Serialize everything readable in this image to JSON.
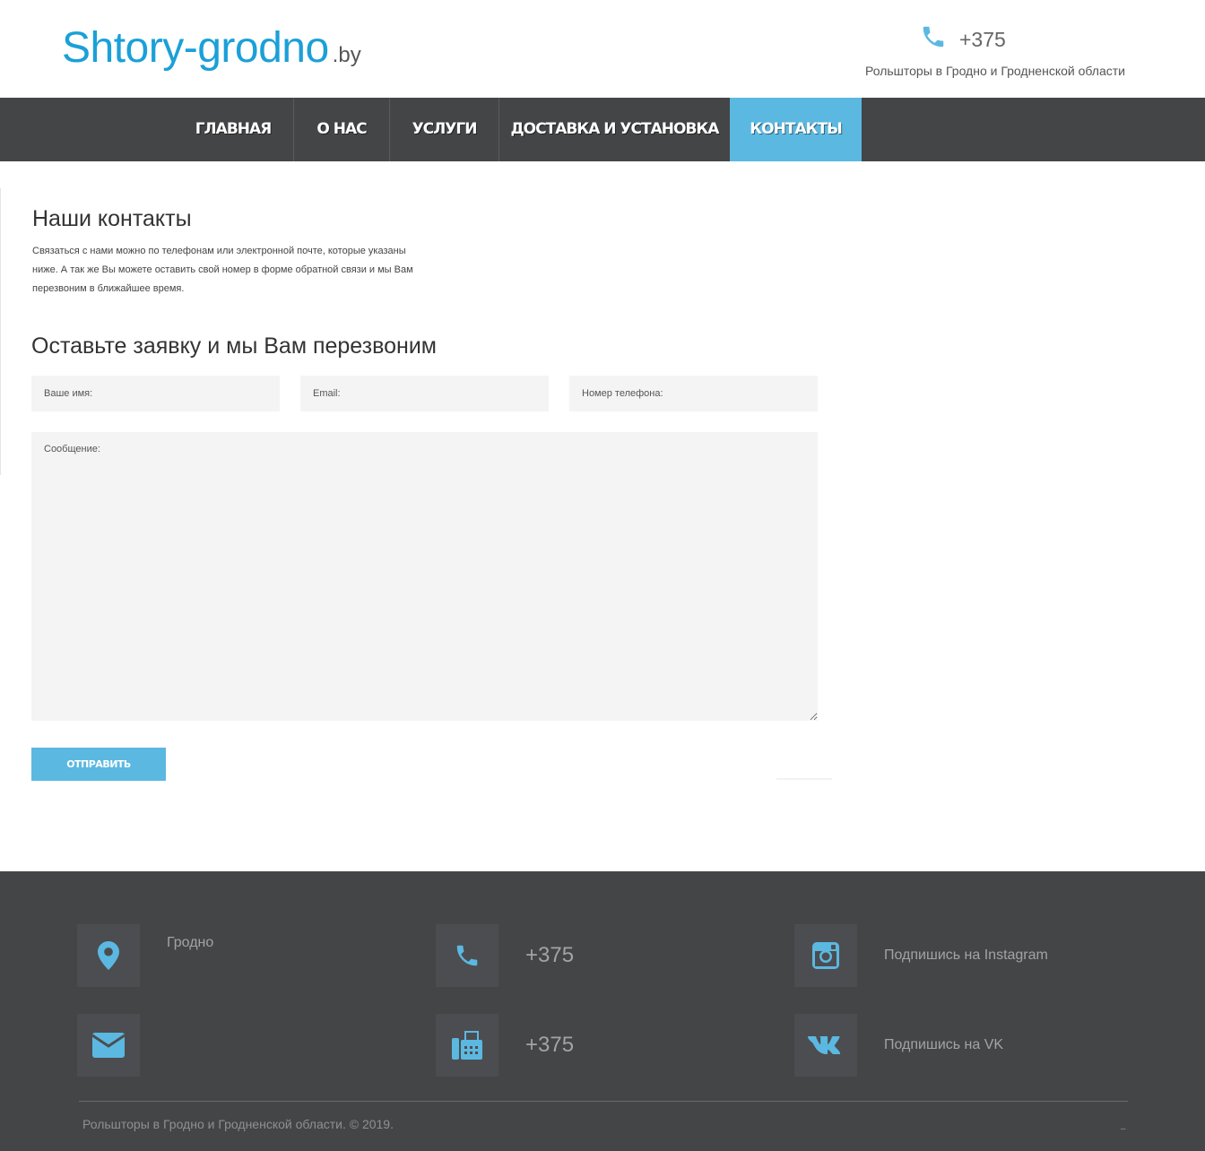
{
  "header": {
    "logo_main": "Shtory-grodno",
    "logo_tld": ".by",
    "phone": "+375",
    "subtitle": "Рольшторы в Гродно и Гродненской области"
  },
  "nav": {
    "items": [
      {
        "label": "ГЛАВНАЯ",
        "active": false
      },
      {
        "label": "О НАС",
        "active": false
      },
      {
        "label": "УСЛУГИ",
        "active": false
      },
      {
        "label": "ДОСТАВКА И УСТАНОВКА",
        "active": false
      },
      {
        "label": "КОНТАКТЫ",
        "active": true
      }
    ]
  },
  "contacts": {
    "title": "Наши контакты",
    "text": "Связаться с нами можно по телефонам или электронной почте, которые указаны ниже. А так же Вы можете оставить свой номер в форме обратной связи и мы Вам перезвоним в ближайшее время."
  },
  "form": {
    "title": "Оставьте заявку и мы Вам перезвоним",
    "name_placeholder": "Ваше имя:",
    "email_placeholder": "Email:",
    "phone_placeholder": "Номер телефона:",
    "message_placeholder": "Сообщение:",
    "submit_label": "ОТПРАВИТЬ"
  },
  "footer": {
    "city": "Гродно",
    "phone": "+375",
    "fax": "+375",
    "instagram": "Подпишись на Instagram",
    "vk": "Подпишись на VK",
    "copyright": "Рольшторы в Гродно и Гродненской области. © 2019.",
    "tick": "–"
  },
  "colors": {
    "accent": "#5bb8e1",
    "logo": "#1ba0d8",
    "dark": "#444547"
  },
  "icons": [
    "phone-icon",
    "location-pin-icon",
    "envelope-icon",
    "fax-icon",
    "instagram-icon",
    "vk-icon"
  ]
}
